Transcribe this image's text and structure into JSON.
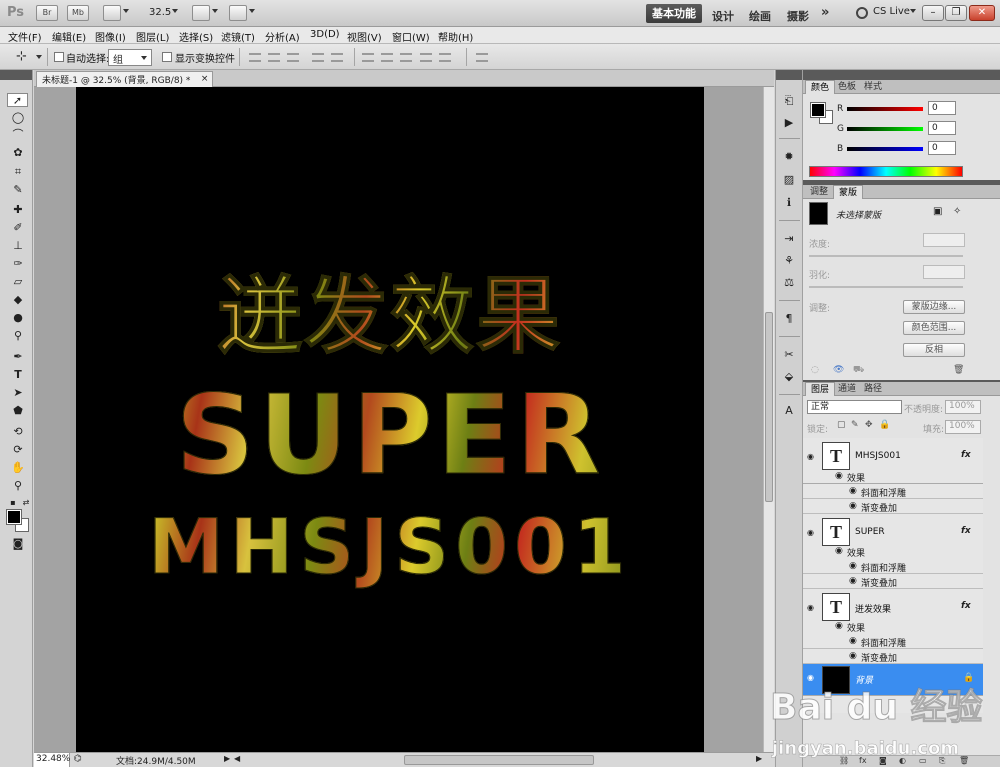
{
  "app": {
    "logo": "Ps",
    "quick_buttons": [
      "Br",
      "Mb"
    ],
    "zoom": "32.5",
    "workspaces": [
      "基本功能",
      "设计",
      "绘画",
      "摄影",
      "»"
    ],
    "cs_live": "CS Live"
  },
  "menu": [
    "文件(F)",
    "编辑(E)",
    "图像(I)",
    "图层(L)",
    "选择(S)",
    "滤镜(T)",
    "分析(A)",
    "3D(D)",
    "视图(V)",
    "窗口(W)",
    "帮助(H)"
  ],
  "options": {
    "auto_select_label": "自动选择:",
    "auto_select_value": "组",
    "show_transform_label": "显示变换控件"
  },
  "document": {
    "tab_title": "未标题-1 @ 32.5% (背景, RGB/8) *",
    "close_glyph": "×",
    "art_lines": [
      "迸发效果",
      "SUPER",
      "MHSJS001"
    ]
  },
  "status": {
    "zoom": "32.48%",
    "doc_info": "文档:24.9M/4.50M"
  },
  "color_panel": {
    "tabs": [
      "颜色",
      "色板",
      "样式"
    ],
    "channels": [
      {
        "label": "R",
        "value": "0",
        "color": "#ff2020"
      },
      {
        "label": "G",
        "value": "0",
        "color": "#20c020"
      },
      {
        "label": "B",
        "value": "0",
        "color": "#2040ff"
      }
    ]
  },
  "masks_panel": {
    "tabs": [
      "调整",
      "蒙版"
    ],
    "no_mask": "未选择蒙版",
    "density_label": "浓度:",
    "feather_label": "羽化:",
    "refine_label": "调整:",
    "buttons": [
      "蒙版边缘...",
      "颜色范围...",
      "反相"
    ]
  },
  "layers_panel": {
    "tabs": [
      "图层",
      "通道",
      "路径"
    ],
    "blend_mode": "正常",
    "opacity_label": "不透明度:",
    "opacity_value": "100%",
    "lock_label": "锁定:",
    "fill_label": "填充:",
    "fill_value": "100%",
    "layers": [
      {
        "name": "MHSJS001",
        "thumb": "T",
        "fx": "fx",
        "effects_label": "效果",
        "effects": [
          "斜面和浮雕",
          "渐变叠加"
        ]
      },
      {
        "name": "SUPER",
        "thumb": "T",
        "fx": "fx",
        "effects_label": "效果",
        "effects": [
          "斜面和浮雕",
          "渐变叠加"
        ]
      },
      {
        "name": "迸发效果",
        "thumb": "T",
        "fx": "fx",
        "effects_label": "效果",
        "effects": [
          "斜面和浮雕",
          "渐变叠加"
        ]
      }
    ],
    "background_layer": "背景"
  },
  "watermark": {
    "brand": "Bai du 经验",
    "url": "jingyan.baidu.com"
  }
}
